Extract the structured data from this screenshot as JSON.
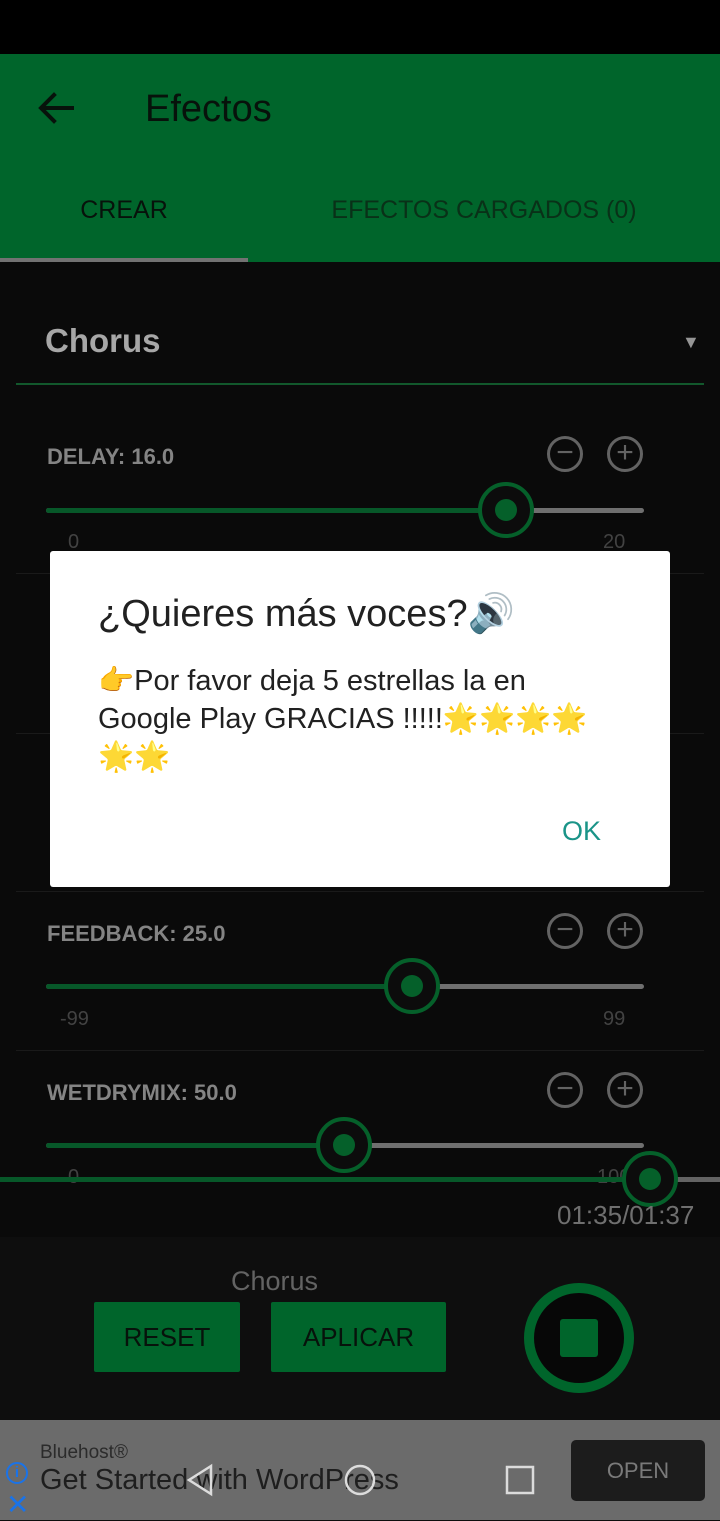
{
  "appbar": {
    "title": "Efectos"
  },
  "tabs": [
    {
      "label": "CREAR"
    },
    {
      "label": "EFECTOS CARGADOS (0)"
    }
  ],
  "effect_selector": {
    "selected": "Chorus"
  },
  "params": [
    {
      "label": "DELAY: 16.0",
      "min": "0",
      "max": "20",
      "value_fraction": 0.8
    },
    {
      "label": "FEEDBACK: 25.0",
      "min": "-99",
      "max": "99",
      "value_fraction": 0.63
    },
    {
      "label": "WETDRYMIX: 50.0",
      "min": "0",
      "max": "100",
      "value_fraction": 0.5
    }
  ],
  "dialog": {
    "title": "¿Quieres más voces?🔊",
    "message": "👉Por favor deja 5 estrellas la en Google Play GRACIAS !!!!!🌟🌟🌟🌟🌟🌟",
    "ok_label": "OK"
  },
  "player": {
    "time": "01:35/01:37",
    "progress_fraction": 0.97
  },
  "bottom": {
    "current_effect": "Chorus",
    "reset_label": "RESET",
    "apply_label": "APLICAR"
  },
  "ad": {
    "brand": "Bluehost®",
    "headline": "Get Started with WordPress",
    "cta": "OPEN"
  },
  "colors": {
    "primary": "#018d3c",
    "accent_dark": "#07863b",
    "dialog_ok": "#1a9488"
  }
}
